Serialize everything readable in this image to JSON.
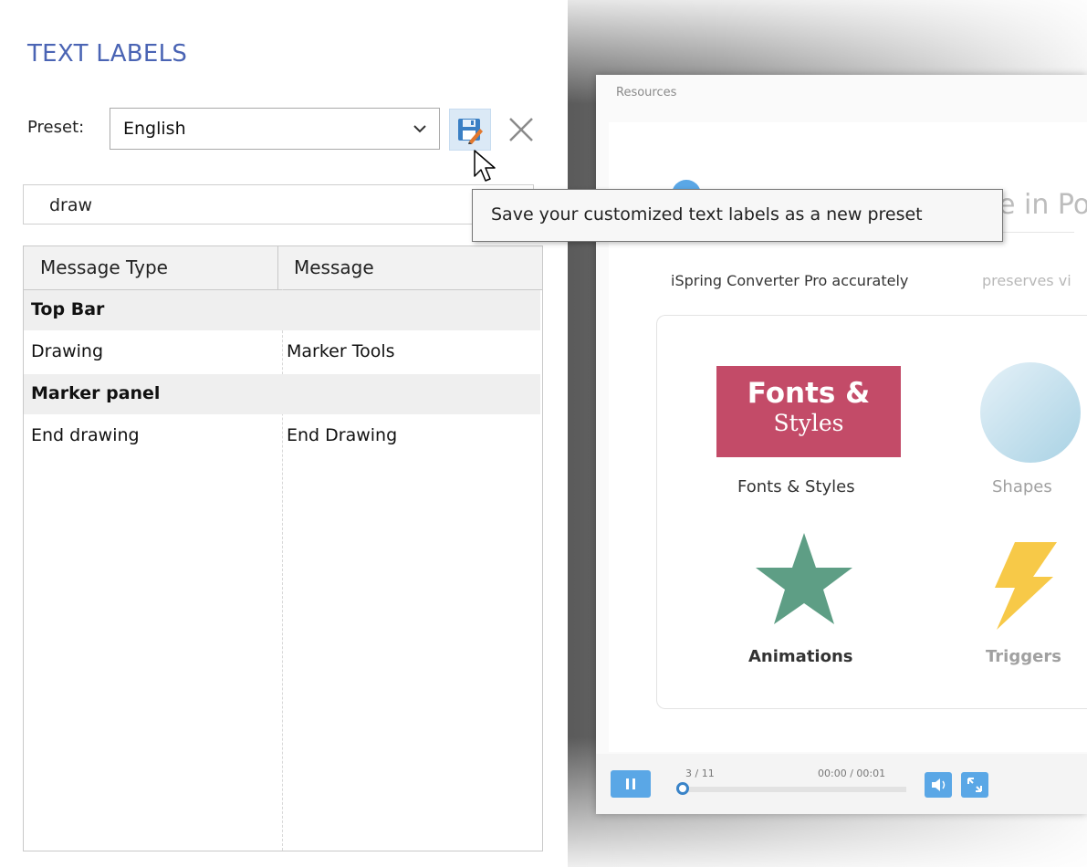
{
  "panel": {
    "title": "TEXT LABELS",
    "preset_label": "Preset:",
    "preset_value": "English",
    "save_tooltip": "Save your customized text labels as a new preset",
    "search_value": "draw"
  },
  "grid": {
    "columns": [
      "Message Type",
      "Message"
    ],
    "groups": [
      {
        "name": "Top Bar",
        "rows": [
          {
            "type": "Drawing",
            "message": "Marker Tools"
          }
        ]
      },
      {
        "name": "Marker panel",
        "rows": [
          {
            "type": "End drawing",
            "message": "End Drawing"
          }
        ]
      }
    ]
  },
  "preview": {
    "window_title": "Resources",
    "heading_partial": "e in Po",
    "subtitle_main": "iSpring Converter Pro accurately",
    "subtitle_faded": "preserves vi",
    "tile_text_line1": "Fonts &",
    "tile_text_line2": "Styles",
    "captions": [
      "Fonts & Styles",
      "Shapes",
      "Animations",
      "Triggers"
    ],
    "slide_counter": "3 / 11",
    "time": "00:00 / 00:01",
    "progress_fraction": 0.0
  },
  "colors": {
    "title_blue": "#4a64b4",
    "tile_red": "#c34b68",
    "star_green": "#5e9e85",
    "bolt_yellow": "#f7c948",
    "player_blue": "#5aa7e6"
  },
  "icons": {
    "preset_dropdown": "chevron-down-icon",
    "save": "save-edit-icon",
    "delete": "close-icon",
    "cursor": "mouse-pointer-icon"
  }
}
